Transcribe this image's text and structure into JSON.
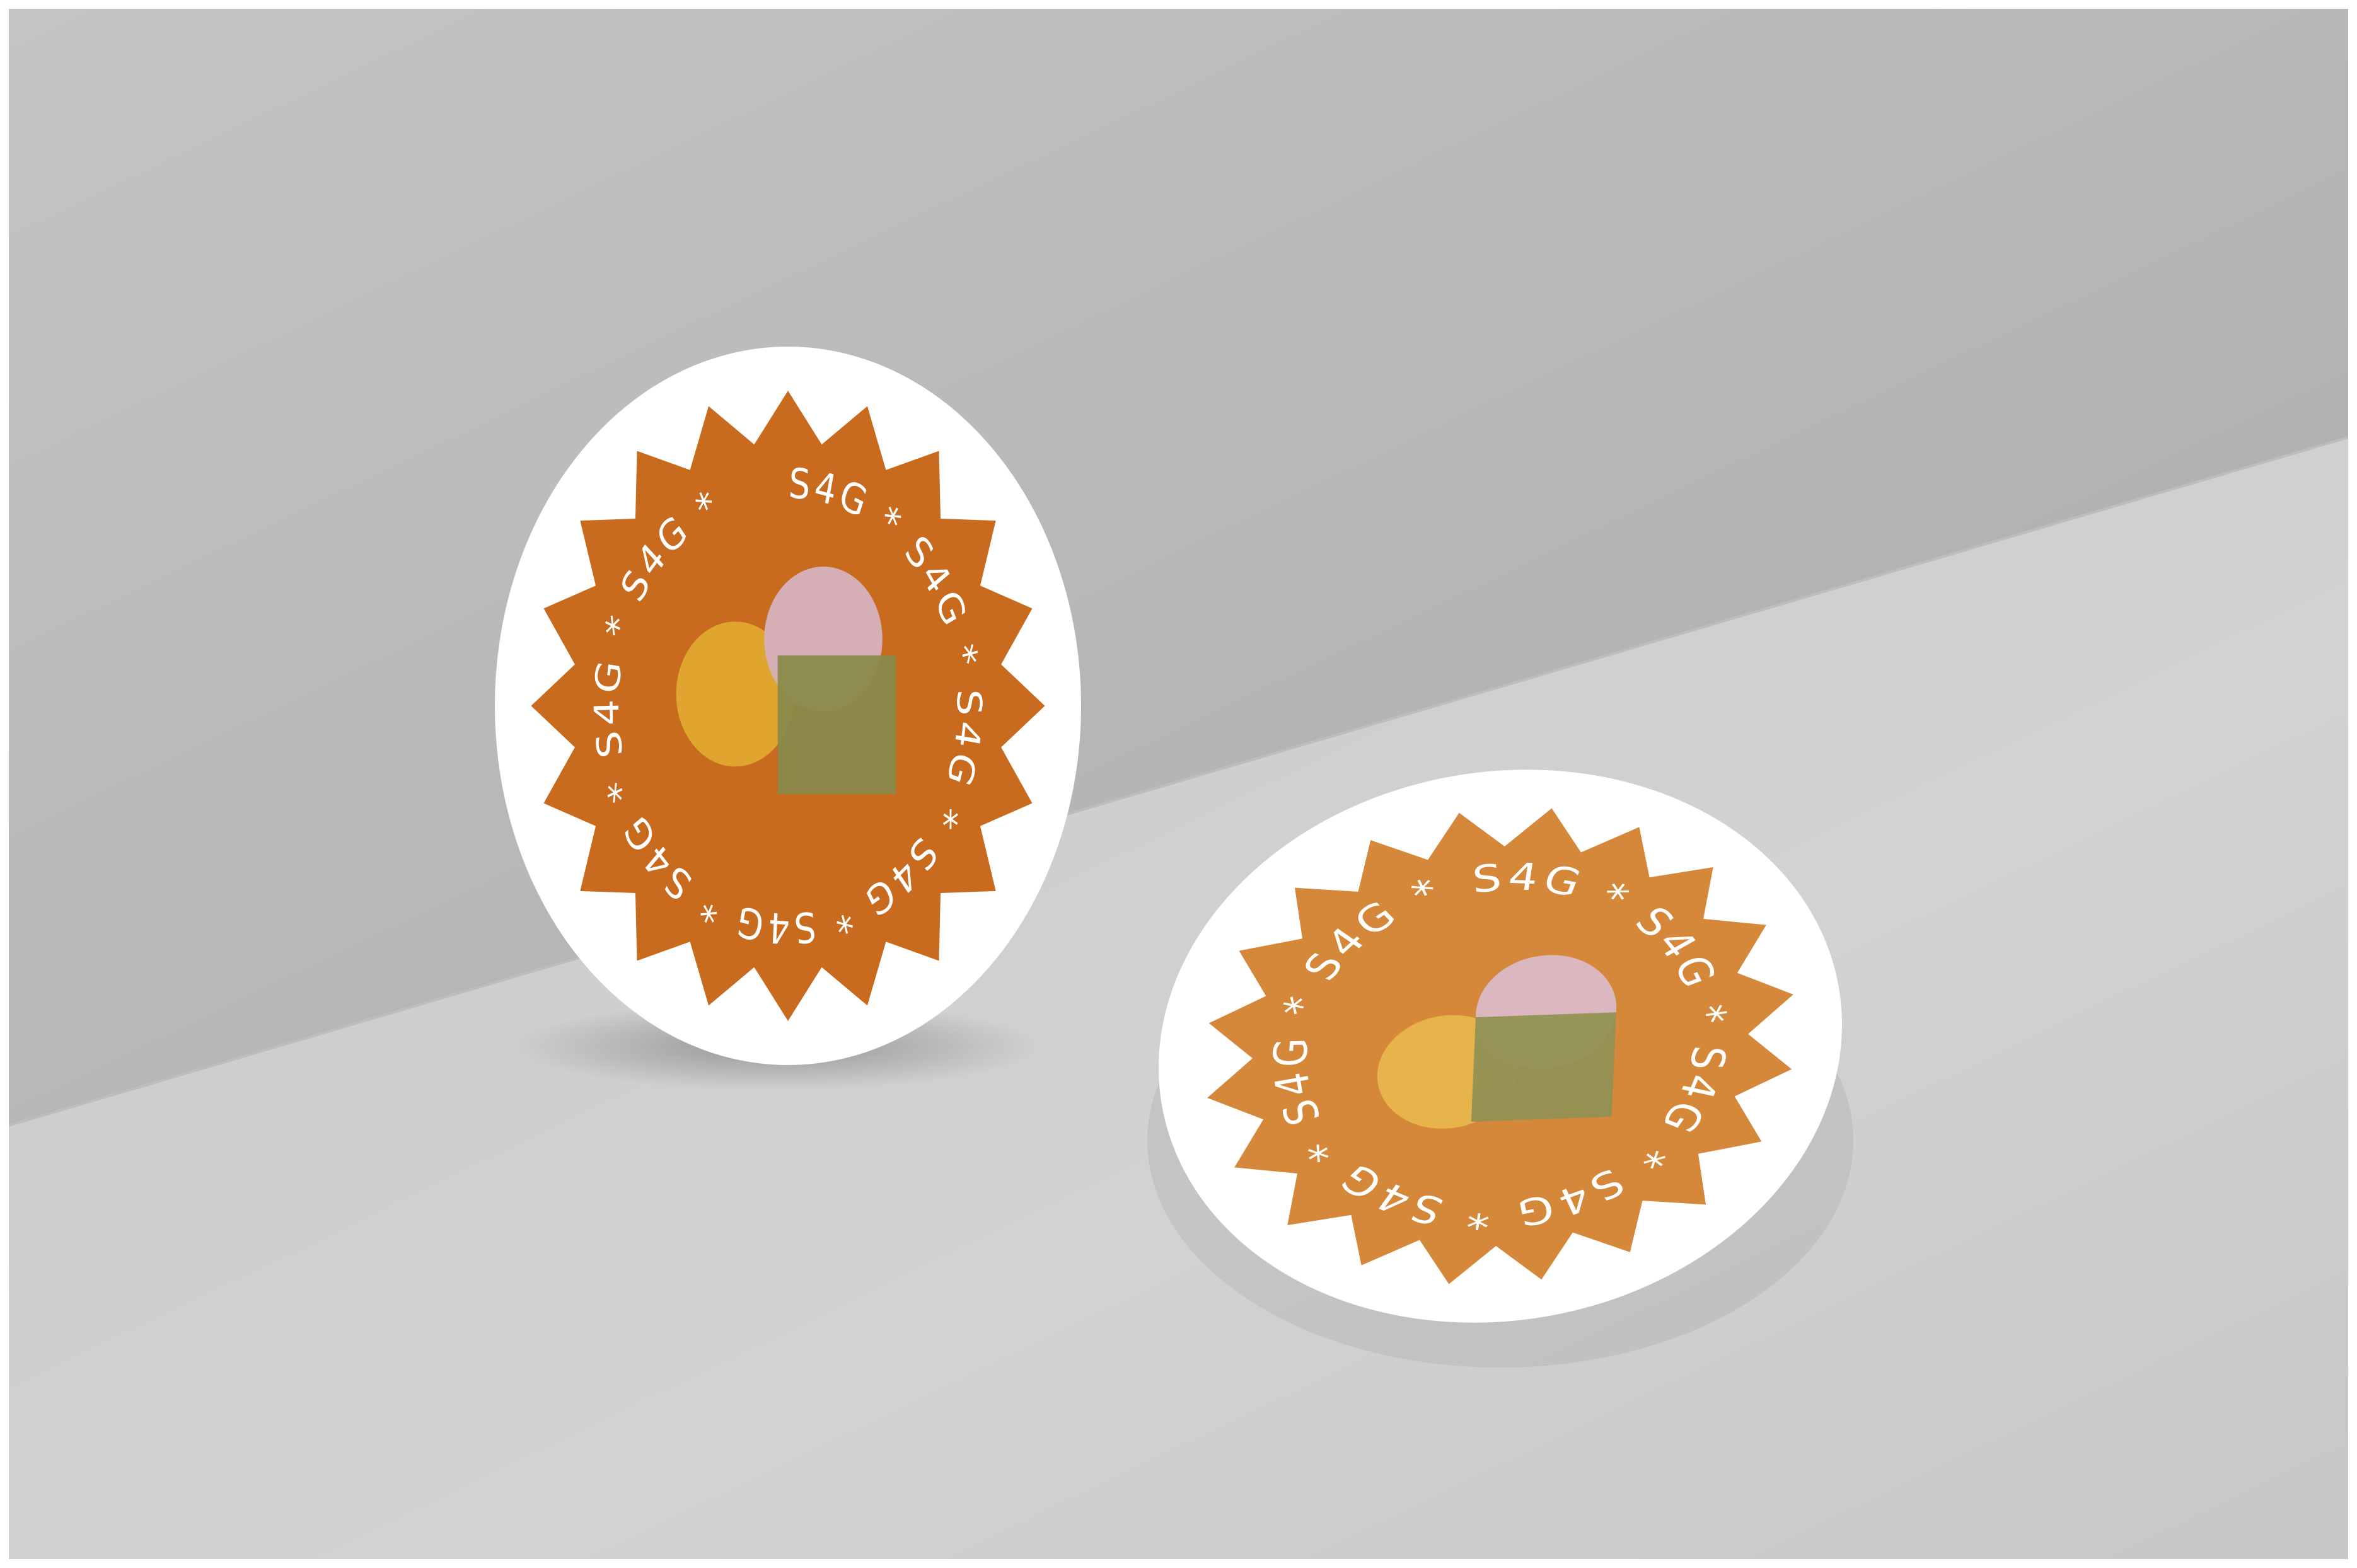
{
  "scene": {
    "wall_color": "#b9b9b9",
    "floor_color": "#cfcfcf",
    "frame_color": "#ffffff"
  },
  "stickers": [
    {
      "id": "upright",
      "ring_text": "S4G * S4G * S4G * S4G * S4G * S4G * S4G * S4G * ",
      "sticker_color": "#ffffff",
      "badge_color": "#c86b1e",
      "heart_colors": {
        "yellow": "#e0a52e",
        "pink": "#d6afb6",
        "green": "#8a8a4a"
      }
    },
    {
      "id": "flat",
      "ring_text": "S4G * S4G * S4G * S4G * S4G * S4G * S4G * S4G * ",
      "sticker_color": "#ffffff",
      "badge_color": "#d6883a",
      "heart_colors": {
        "yellow": "#e6b44a",
        "pink": "#dbb8bf",
        "green": "#929153"
      }
    }
  ]
}
